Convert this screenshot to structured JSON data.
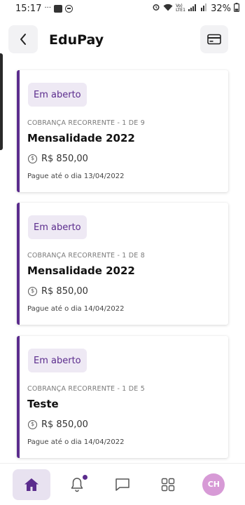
{
  "status_bar": {
    "time": "15:17",
    "battery": "32%",
    "network_label": "Vo) LTE1"
  },
  "header": {
    "title": "EduPay"
  },
  "charges": [
    {
      "status": "Em aberto",
      "recurrence": "COBRANÇA RECORRENTE - 1 DE 9",
      "title": "Mensalidade 2022",
      "amount": "R$ 850,00",
      "due": "Pague até o dia 13/04/2022"
    },
    {
      "status": "Em aberto",
      "recurrence": "COBRANÇA RECORRENTE - 1 DE 8",
      "title": "Mensalidade 2022",
      "amount": "R$ 850,00",
      "due": "Pague até o dia 14/04/2022"
    },
    {
      "status": "Em aberto",
      "recurrence": "COBRANÇA RECORRENTE - 1 DE 5",
      "title": "Teste",
      "amount": "R$ 850,00",
      "due": "Pague até o dia 14/04/2022"
    }
  ],
  "bottom_nav": {
    "items": [
      {
        "icon": "home-icon",
        "active": true
      },
      {
        "icon": "bell-icon",
        "has_dot": true
      },
      {
        "icon": "chat-icon"
      },
      {
        "icon": "grid-icon"
      }
    ],
    "avatar_initials": "CH"
  },
  "colors": {
    "accent": "#5b2c8d",
    "badge_bg": "#eee9f4",
    "avatar_bg": "#d79ad6"
  }
}
